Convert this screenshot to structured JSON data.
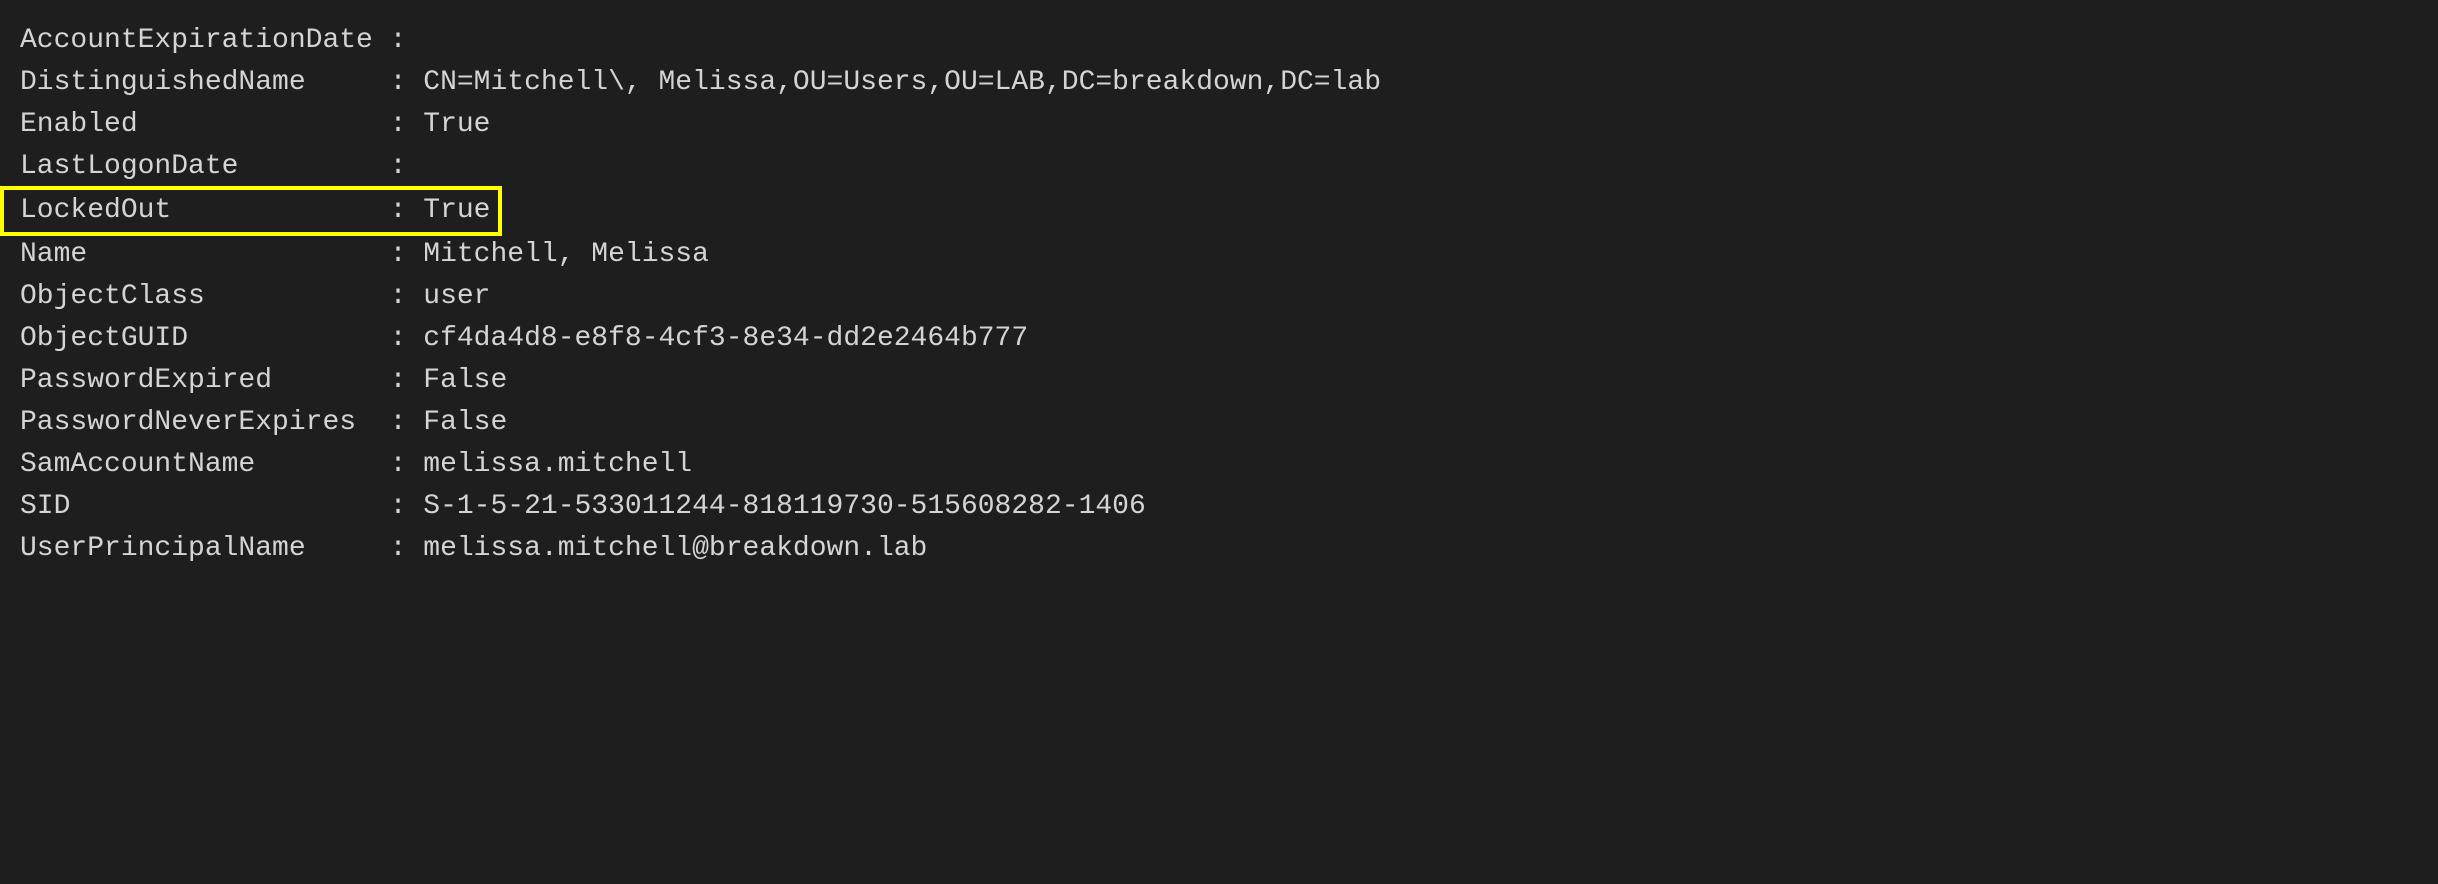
{
  "properties": [
    {
      "key": "AccountExpirationDate",
      "value": "",
      "highlight": false
    },
    {
      "key": "DistinguishedName",
      "value": "CN=Mitchell\\, Melissa,OU=Users,OU=LAB,DC=breakdown,DC=lab",
      "highlight": false
    },
    {
      "key": "Enabled",
      "value": "True",
      "highlight": false
    },
    {
      "key": "LastLogonDate",
      "value": "",
      "highlight": false
    },
    {
      "key": "LockedOut",
      "value": "True",
      "highlight": true
    },
    {
      "key": "Name",
      "value": "Mitchell, Melissa",
      "highlight": false
    },
    {
      "key": "ObjectClass",
      "value": "user",
      "highlight": false
    },
    {
      "key": "ObjectGUID",
      "value": "cf4da4d8-e8f8-4cf3-8e34-dd2e2464b777",
      "highlight": false
    },
    {
      "key": "PasswordExpired",
      "value": "False",
      "highlight": false
    },
    {
      "key": "PasswordNeverExpires",
      "value": "False",
      "highlight": false
    },
    {
      "key": "SamAccountName",
      "value": "melissa.mitchell",
      "highlight": false
    },
    {
      "key": "SID",
      "value": "S-1-5-21-533011244-818119730-515608282-1406",
      "highlight": false
    },
    {
      "key": "UserPrincipalName",
      "value": "melissa.mitchell@breakdown.lab",
      "highlight": false
    }
  ],
  "separator": " : "
}
